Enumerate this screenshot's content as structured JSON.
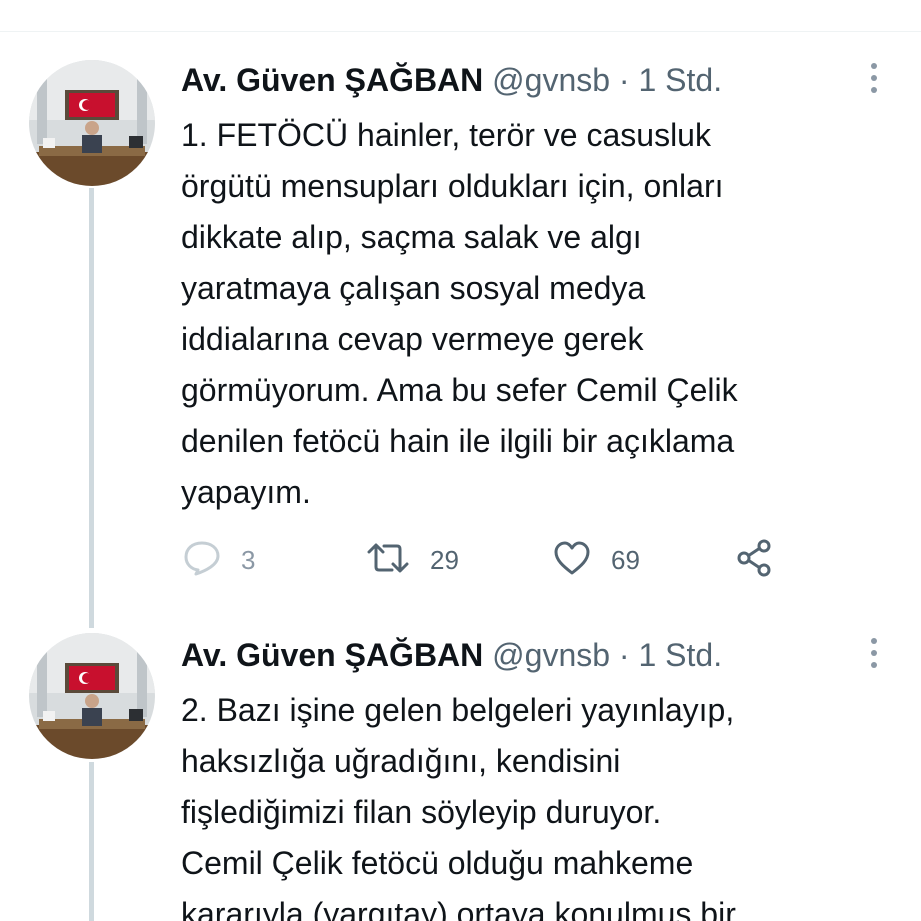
{
  "tweets": [
    {
      "author_name": "Av. Güven ŞAĞBAN",
      "handle_time": "@gvnsb · 1 Std.",
      "text": "1. FETÖCÜ hainler, terör ve casusluk\nörgütü mensupları oldukları için, onları\ndikkate alıp, saçma salak ve algı\nyaratmaya çalışan sosyal medya\niddialarına cevap vermeye gerek\ngörmüyorum. Ama bu sefer Cemil Çelik\ndenilen fetöcü hain ile ilgili bir açıklama\nyapayım.",
      "reply_count": "3",
      "retweet_count": "29",
      "like_count": "69"
    },
    {
      "author_name": "Av. Güven ŞAĞBAN",
      "handle_time": "@gvnsb · 1 Std.",
      "text": "2. Bazı işine gelen belgeleri yayınlayıp,\nhaksızlığa uğradığını, kendisini\nfişlediğimizi filan söyleyip duruyor.\nCemil Çelik fetöcü olduğu mahkeme\nkararıyla (yargıtay) ortaya konulmuş bir"
    }
  ],
  "icons": {
    "reply": "reply-icon",
    "retweet": "retweet-icon",
    "like": "like-icon",
    "share": "share-icon",
    "more": "more-icon"
  },
  "colors": {
    "text": "#0f1419",
    "secondary": "#536471",
    "thread_line": "#cfd9de",
    "divider": "#eff3f4"
  }
}
